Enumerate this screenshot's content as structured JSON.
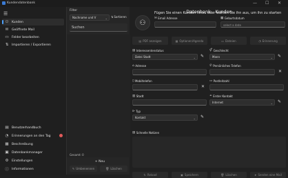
{
  "window": {
    "title": "Kundendatenbank",
    "minimize": "—",
    "maximize": "☐",
    "close": "✕"
  },
  "sidebar": {
    "menu_icon": "☰",
    "top_items": [
      {
        "icon": "person-icon",
        "glyph": "⚇",
        "label": "Kunden",
        "active": true
      },
      {
        "icon": "mail-icon",
        "glyph": "✉",
        "label": "Geöffnete Mail",
        "active": false
      },
      {
        "icon": "folder-icon",
        "glyph": "▭",
        "label": "Felder bearbeiten",
        "active": false
      },
      {
        "icon": "import-export-icon",
        "glyph": "⇅",
        "label": "Importieren / Exportieren",
        "active": false
      }
    ],
    "bottom_items": [
      {
        "icon": "book-icon",
        "glyph": "▤",
        "label": "Benutzerhandbuch"
      },
      {
        "icon": "bell-icon",
        "glyph": "◔",
        "label": "Erinnerungen an den Tag",
        "badge": true
      },
      {
        "icon": "description-icon",
        "glyph": "▦",
        "label": "Beschreibung"
      },
      {
        "icon": "database-icon",
        "glyph": "▣",
        "label": "Datenbankmanager"
      },
      {
        "icon": "gear-icon",
        "glyph": "⚙",
        "label": "Einstellungen"
      },
      {
        "icon": "info-icon",
        "glyph": "ⓘ",
        "label": "Informationen"
      }
    ]
  },
  "list_pane": {
    "filter_label": "Filter",
    "sort_field": "Nachname und V",
    "sort_button": "Sortieren",
    "search_placeholder": "Suchen",
    "total_label": "Gesamt: 0",
    "new_button": "+ Neu",
    "bottom_buttons": [
      "Umbenennen",
      "Löschen"
    ]
  },
  "detail": {
    "title": "Datenbank - Kunden",
    "prompt": "Fügen Sie einen Kunden hinzu oder wählen Sie ihn aus, um ihn zu starten",
    "email_label": "Email Adresse",
    "birthday_label": "Geburtsdatum",
    "birthday_placeholder": "select a date",
    "actions": [
      "PDF anzeigen",
      "Optionen/Agenda",
      "Dateien",
      "Erinnerung"
    ],
    "fields": {
      "interest_label": "Interessentenstatus",
      "interest_value": "Datei Stadt",
      "gender_label": "Geschlecht",
      "gender_value": "Mann",
      "address_label": "Adresse",
      "phone_label": "Persönliches Telefon",
      "mobile_label": "Mobiltelefon",
      "postcode_label": "Postleitzahl",
      "city_label": "Stadt",
      "first_contact_label": "Erster Kontakt",
      "first_contact_value": "Internet",
      "type_label": "Typ",
      "type_value": "Kontakt",
      "notes_label": "Schnelle Notizen"
    },
    "footer_buttons": [
      "Reload",
      "Speichern",
      "Löschen",
      "Senden eine Mail"
    ]
  }
}
